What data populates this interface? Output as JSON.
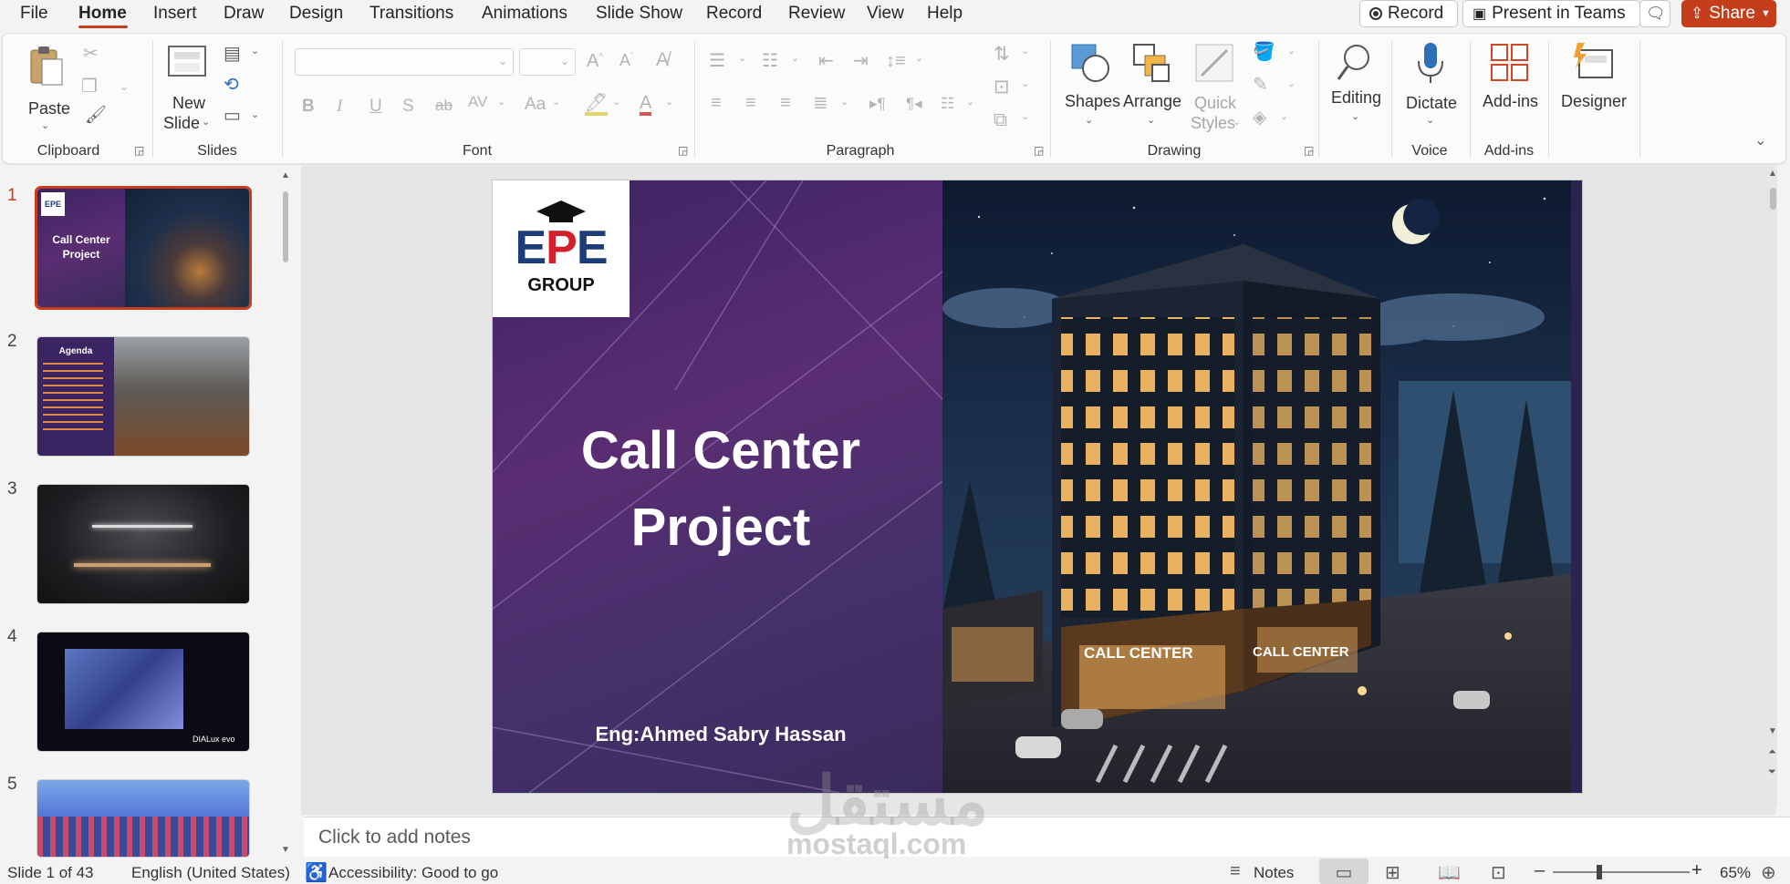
{
  "menu": {
    "tabs": [
      "File",
      "Home",
      "Insert",
      "Draw",
      "Design",
      "Transitions",
      "Animations",
      "Slide Show",
      "Record",
      "Review",
      "View",
      "Help"
    ],
    "active": "Home",
    "record_label": "Record",
    "teams_label": "Present in Teams",
    "share_label": "Share"
  },
  "ribbon": {
    "clipboard": {
      "paste": "Paste",
      "label": "Clipboard"
    },
    "slides": {
      "new_slide_1": "New",
      "new_slide_2": "Slide",
      "label": "Slides"
    },
    "font": {
      "label": "Font"
    },
    "paragraph": {
      "label": "Paragraph"
    },
    "drawing": {
      "shapes": "Shapes",
      "arrange": "Arrange",
      "quick_styles_1": "Quick",
      "quick_styles_2": "Styles",
      "label": "Drawing"
    },
    "editing": {
      "label_btn": "Editing"
    },
    "voice": {
      "dictate": "Dictate",
      "label": "Voice"
    },
    "addins": {
      "btn": "Add-ins",
      "label": "Add-ins"
    },
    "designer": {
      "btn": "Designer"
    }
  },
  "thumbnails": [
    {
      "num": "1",
      "title": "Call Center Project"
    },
    {
      "num": "2",
      "title": "Agenda"
    },
    {
      "num": "3"
    },
    {
      "num": "4",
      "caption": "DIALux evo"
    },
    {
      "num": "5"
    }
  ],
  "slide": {
    "logo_main": "EPE",
    "logo_sub": "GROUP",
    "title_line1": "Call Center",
    "title_line2": "Project",
    "author": "Eng:Ahmed Sabry Hassan",
    "sign_text": "CALL CENTER"
  },
  "notes": {
    "placeholder": "Click to add notes"
  },
  "watermark": {
    "arabic": "مستقل",
    "latin": "mostaql.com"
  },
  "status": {
    "slide_count": "Slide 1 of 43",
    "language": "English (United States)",
    "accessibility": "Accessibility: Good to go",
    "notes_btn": "Notes",
    "zoom": "65%"
  },
  "colors": {
    "accent": "#c43e1c",
    "slide_purple": "#4a2a6a"
  }
}
